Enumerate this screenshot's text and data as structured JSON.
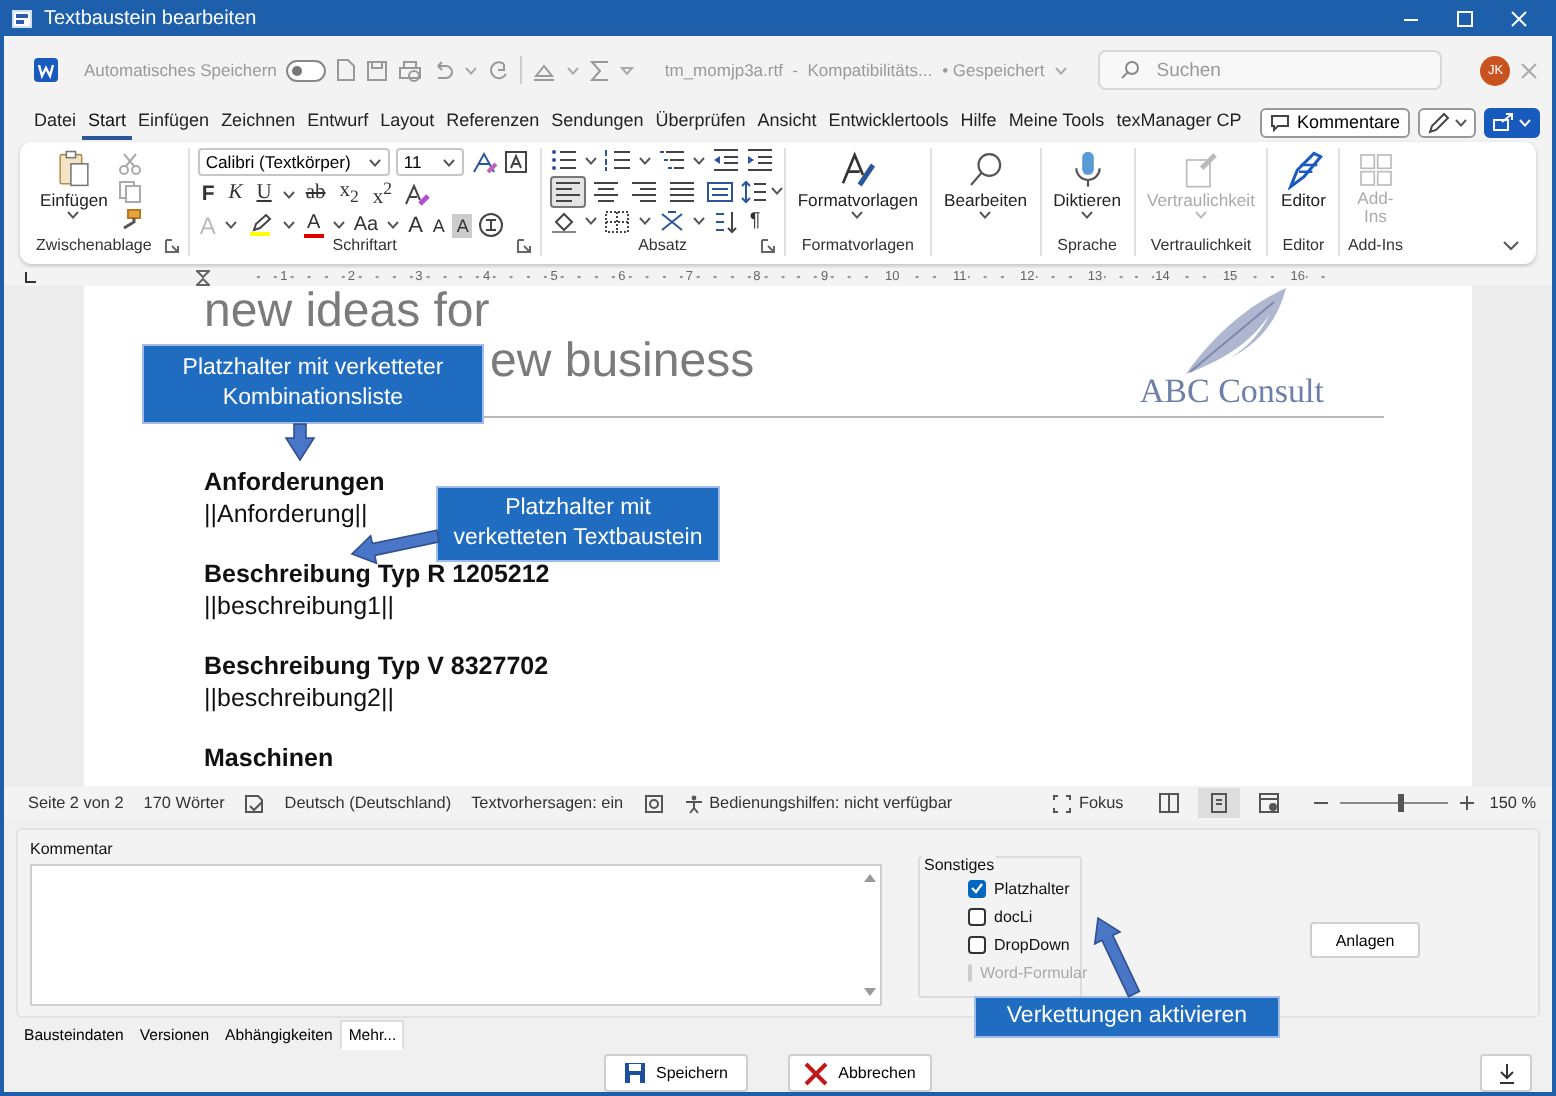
{
  "window": {
    "title": "Textbaustein bearbeiten"
  },
  "quick_access": {
    "autosave_label": "Automatisches Speichern",
    "autosave_on": false,
    "filename": "tm_momjp3a.rtf  -  Kompatibilitäts...",
    "saved_status": "• Gespeichert",
    "search": {
      "placeholder": "Suchen"
    },
    "avatar": "JK"
  },
  "menu_tabs": [
    {
      "label": "Datei",
      "selected": false
    },
    {
      "label": "Start",
      "selected": true
    },
    {
      "label": "Einfügen",
      "selected": false
    },
    {
      "label": "Zeichnen",
      "selected": false
    },
    {
      "label": "Entwurf",
      "selected": false
    },
    {
      "label": "Layout",
      "selected": false
    },
    {
      "label": "Referenzen",
      "selected": false
    },
    {
      "label": "Sendungen",
      "selected": false
    },
    {
      "label": "Überprüfen",
      "selected": false
    },
    {
      "label": "Ansicht",
      "selected": false
    },
    {
      "label": "Entwicklertools",
      "selected": false
    },
    {
      "label": "Hilfe",
      "selected": false
    },
    {
      "label": "Meine Tools",
      "selected": false
    },
    {
      "label": "texManager CP",
      "selected": false
    }
  ],
  "comments_button": "Kommentare",
  "ribbon": {
    "clipboard": {
      "paste": "Einfügen",
      "label": "Zwischenablage"
    },
    "font": {
      "name": "Calibri (Textkörper)",
      "size": "11",
      "label": "Schriftart",
      "format": [
        {
          "kind": "bold",
          "text": "F"
        },
        {
          "kind": "italic",
          "text": "K"
        },
        {
          "kind": "underline",
          "text": "U"
        },
        {
          "kind": "strike",
          "text": "ab"
        },
        {
          "kind": "sub",
          "text": "x$_{2}$"
        },
        {
          "kind": "super",
          "text": "x$^{2}$"
        },
        {
          "kind": "clear"
        }
      ],
      "effects": [
        {
          "kind": "effects",
          "text": "A"
        },
        {
          "kind": "highlight",
          "color": "#ffff00"
        },
        {
          "kind": "color",
          "text": "A",
          "color": "#e00000"
        },
        {
          "kind": "case",
          "text": "Aa"
        },
        {
          "kind": "grow",
          "text": "A"
        },
        {
          "kind": "shrink",
          "text": "A"
        },
        {
          "kind": "shade",
          "text": "A"
        },
        {
          "kind": "enclose"
        }
      ]
    },
    "paragraph": {
      "label": "Absatz",
      "marks_button": "¶",
      "alignment": [
        {
          "kind": "left",
          "selected": true
        },
        {
          "kind": "center",
          "selected": false
        },
        {
          "kind": "right",
          "selected": false
        },
        {
          "kind": "justify",
          "selected": false
        },
        {
          "kind": "distributed",
          "selected": false
        }
      ]
    },
    "groups": [
      {
        "kind": "styles",
        "button": "Formatvorlagen",
        "label": "Formatvorlagen",
        "dropdown": true,
        "disabled": false
      },
      {
        "kind": "search",
        "button": "Bearbeiten",
        "dropdown": true,
        "disabled": false
      },
      {
        "kind": "dictate",
        "button": "Diktieren",
        "label": "Sprache",
        "dropdown": true,
        "disabled": false
      },
      {
        "kind": "sensitivity",
        "button": "Vertraulichkeit",
        "label": "Vertraulichkeit",
        "dropdown": true,
        "disabled": true
      },
      {
        "kind": "editor",
        "button": "Editor",
        "label": "Editor",
        "dropdown": false,
        "disabled": false
      },
      {
        "kind": "addins",
        "button": "Add-Ins",
        "label": "Add-Ins",
        "dropdown": false,
        "disabled": true
      }
    ]
  },
  "ruler": [
    "1",
    "2",
    "3",
    "4",
    "5",
    "6",
    "7",
    "8",
    "9",
    "10",
    "11",
    "12",
    "13",
    "14",
    "15",
    "16"
  ],
  "document": {
    "title_lines": [
      "new ideas for",
      "ew business"
    ],
    "logo": "ABC Consult",
    "paragraphs": [
      {
        "kind": "heading",
        "text": "Anforderungen"
      },
      {
        "kind": "field",
        "text": "||Anforderung||"
      },
      {
        "kind": "heading",
        "text": "Beschreibung Typ R 1205212"
      },
      {
        "kind": "field",
        "text": "||beschreibung1||"
      },
      {
        "kind": "heading",
        "text": "Beschreibung Typ V 8327702"
      },
      {
        "kind": "field",
        "text": "||beschreibung2||"
      },
      {
        "kind": "heading",
        "text": "Maschinen"
      }
    ]
  },
  "annotations": [
    {
      "text": "Platzhalter mit verketteter Kombinationsliste"
    },
    {
      "text": "Platzhalter mit verketteten Textbaustein"
    },
    {
      "text": "Verkettungen aktivieren"
    }
  ],
  "status_bar": {
    "page": "Seite 2 von 2",
    "words": "170 Wörter",
    "language": "Deutsch (Deutschland)",
    "predictions": "Textvorhersagen: ein",
    "accessibility": "Bedienungshilfen: nicht verfügbar",
    "focus": "Fokus",
    "views": [
      {
        "kind": "read",
        "selected": false
      },
      {
        "kind": "print",
        "selected": true
      },
      {
        "kind": "web",
        "selected": false
      }
    ],
    "zoom": {
      "level": 0.56,
      "reading": "150 %"
    }
  },
  "panel": {
    "comment_label": "Kommentar",
    "options_title": "Sonstiges",
    "options": [
      {
        "label": "Platzhalter",
        "checked": true,
        "disabled": false
      },
      {
        "label": "docLi",
        "checked": false,
        "disabled": false
      },
      {
        "label": "DropDown",
        "checked": false,
        "disabled": false
      },
      {
        "label": "Word-Formular",
        "checked": false,
        "disabled": true
      }
    ],
    "attachments_button": "Anlagen",
    "tabs": [
      {
        "label": "Bausteindaten",
        "selected": false
      },
      {
        "label": "Versionen",
        "selected": false
      },
      {
        "label": "Abhängigkeiten",
        "selected": false
      },
      {
        "label": "Mehr...",
        "selected": true
      }
    ],
    "buttons": [
      {
        "kind": "save",
        "label": "Speichern"
      },
      {
        "kind": "cancel",
        "label": "Abbrechen"
      }
    ]
  }
}
